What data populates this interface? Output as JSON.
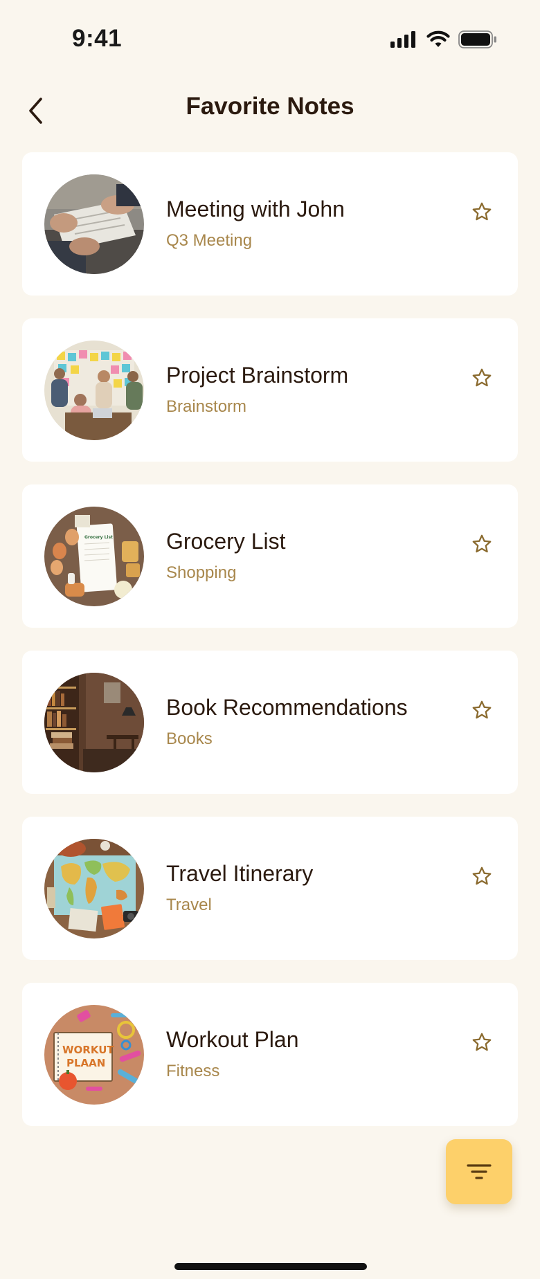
{
  "status_bar": {
    "time": "9:41",
    "icons": [
      "signal-icon",
      "wifi-icon",
      "battery-icon"
    ]
  },
  "header": {
    "title": "Favorite Notes",
    "back_icon": "chevron-left-icon"
  },
  "notes": [
    {
      "title": "Meeting with John",
      "subtitle": "Q3 Meeting",
      "thumbnail": "meeting-photo",
      "favorite_icon": "star-outline-icon"
    },
    {
      "title": "Project Brainstorm",
      "subtitle": "Brainstorm",
      "thumbnail": "brainstorm-photo",
      "favorite_icon": "star-outline-icon"
    },
    {
      "title": "Grocery List",
      "subtitle": "Shopping",
      "thumbnail": "grocery-photo",
      "favorite_icon": "star-outline-icon"
    },
    {
      "title": "Book Recommendations",
      "subtitle": "Books",
      "thumbnail": "books-photo",
      "favorite_icon": "star-outline-icon"
    },
    {
      "title": "Travel Itinerary",
      "subtitle": "Travel",
      "thumbnail": "travel-map-photo",
      "favorite_icon": "star-outline-icon"
    },
    {
      "title": "Workout Plan",
      "subtitle": "Fitness",
      "thumbnail": "workout-photo",
      "favorite_icon": "star-outline-icon"
    }
  ],
  "fab": {
    "icon": "filter-icon"
  },
  "thumbnail_text": {
    "grocery_notebook": "Grocery List",
    "workout_line1": "WORKUT",
    "workout_line2": "PLAAN"
  },
  "colors": {
    "background": "#faf6ee",
    "card": "#ffffff",
    "title_text": "#2b1a0f",
    "subtitle_text": "#a8874c",
    "star": "#8a6a2e",
    "fab": "#fdd06a"
  }
}
